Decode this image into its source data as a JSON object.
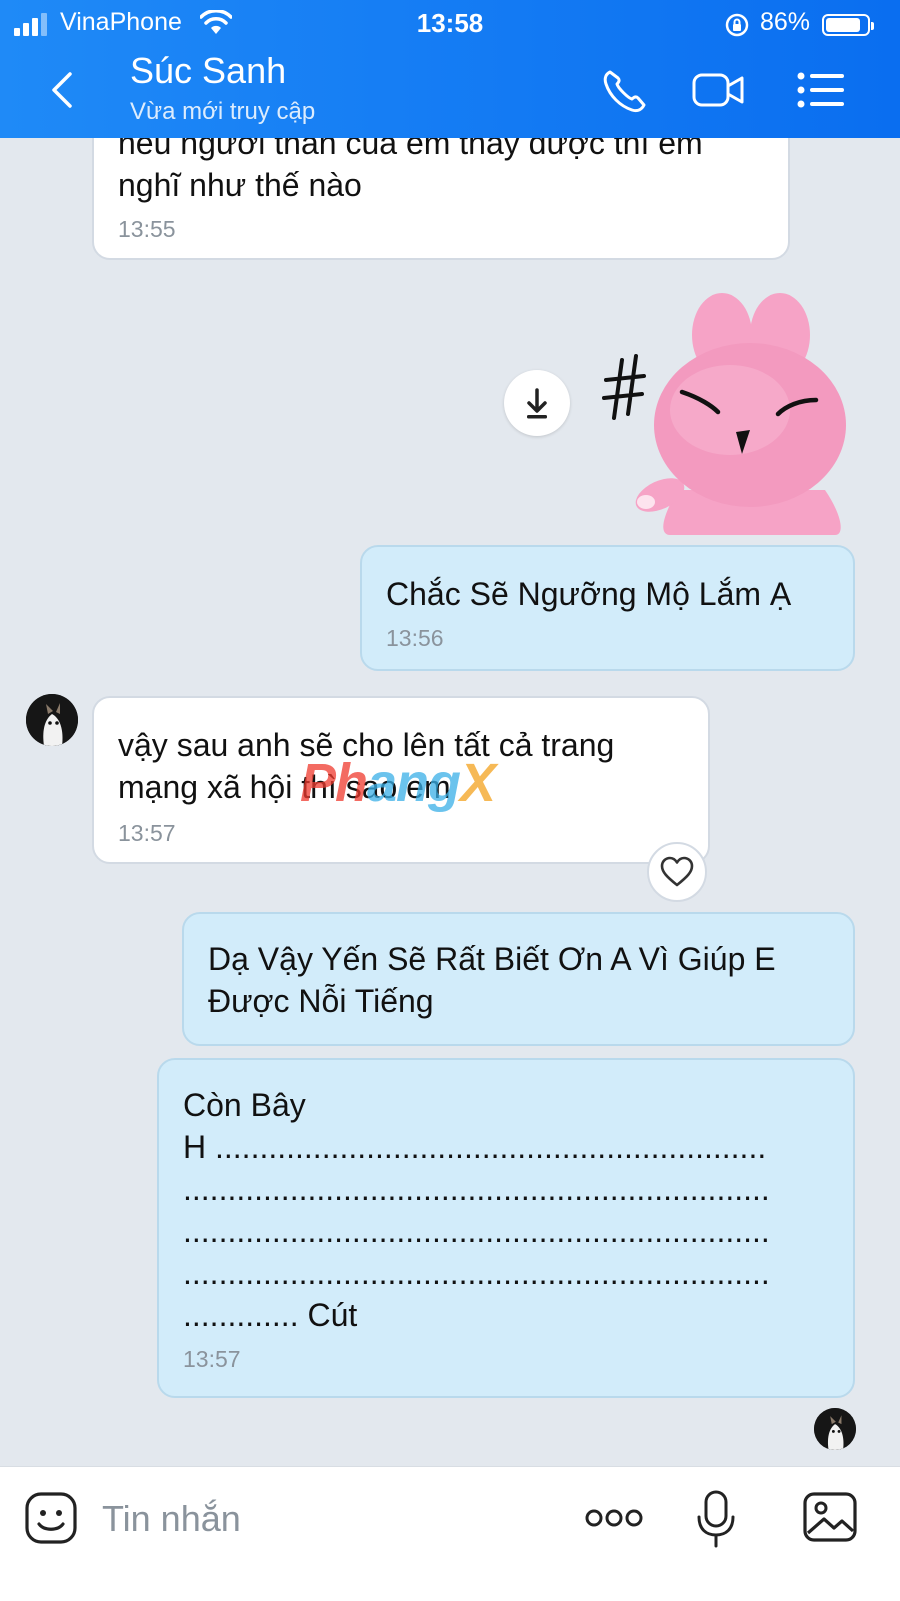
{
  "status_bar": {
    "carrier": "VinaPhone",
    "time": "13:58",
    "battery": "86%",
    "battery_level": 0.86
  },
  "header": {
    "contact_name": "Súc Sanh",
    "contact_status": "Vừa mới truy cập"
  },
  "messages": [
    {
      "lines": [
        "nếu người thân của em thấy được thì em",
        "nghĩ như thế nào"
      ],
      "time": "13:55"
    },
    {
      "type": "sticker",
      "sticker": "pink-bunny-sticker"
    },
    {
      "text": "Chắc Sẽ Ngưỡng Mộ Lắm Ạ",
      "time": "13:56"
    },
    {
      "lines": [
        "vậy sau anh sẽ cho lên tất cả trang",
        "mạng xã hội thì sao em"
      ],
      "time": "13:57"
    },
    {
      "lines": [
        "Dạ Vậy Yến Sẽ Rất Biết Ơn A Vì Giúp E",
        "Được Nỗi Tiếng"
      ]
    },
    {
      "lines": [
        "Còn Bây",
        "H ..............................................................",
        "..................................................................",
        "..................................................................",
        "..................................................................",
        "............. Cút"
      ],
      "time": "13:57"
    }
  ],
  "watermark": {
    "part1": "Ph",
    "part2": "ang",
    "part3": "X"
  },
  "input": {
    "placeholder": "Tin nhắn"
  },
  "colors": {
    "header": "#0a6ef0",
    "outgoing_bubble": "#d2ecfa",
    "incoming_bubble": "#ffffff",
    "background": "#e3e8ee"
  },
  "icons": [
    "back-icon",
    "phone-icon",
    "video-icon",
    "menu-icon",
    "download-icon",
    "heart-icon",
    "emoji-icon",
    "more-icon",
    "mic-icon",
    "image-icon"
  ]
}
